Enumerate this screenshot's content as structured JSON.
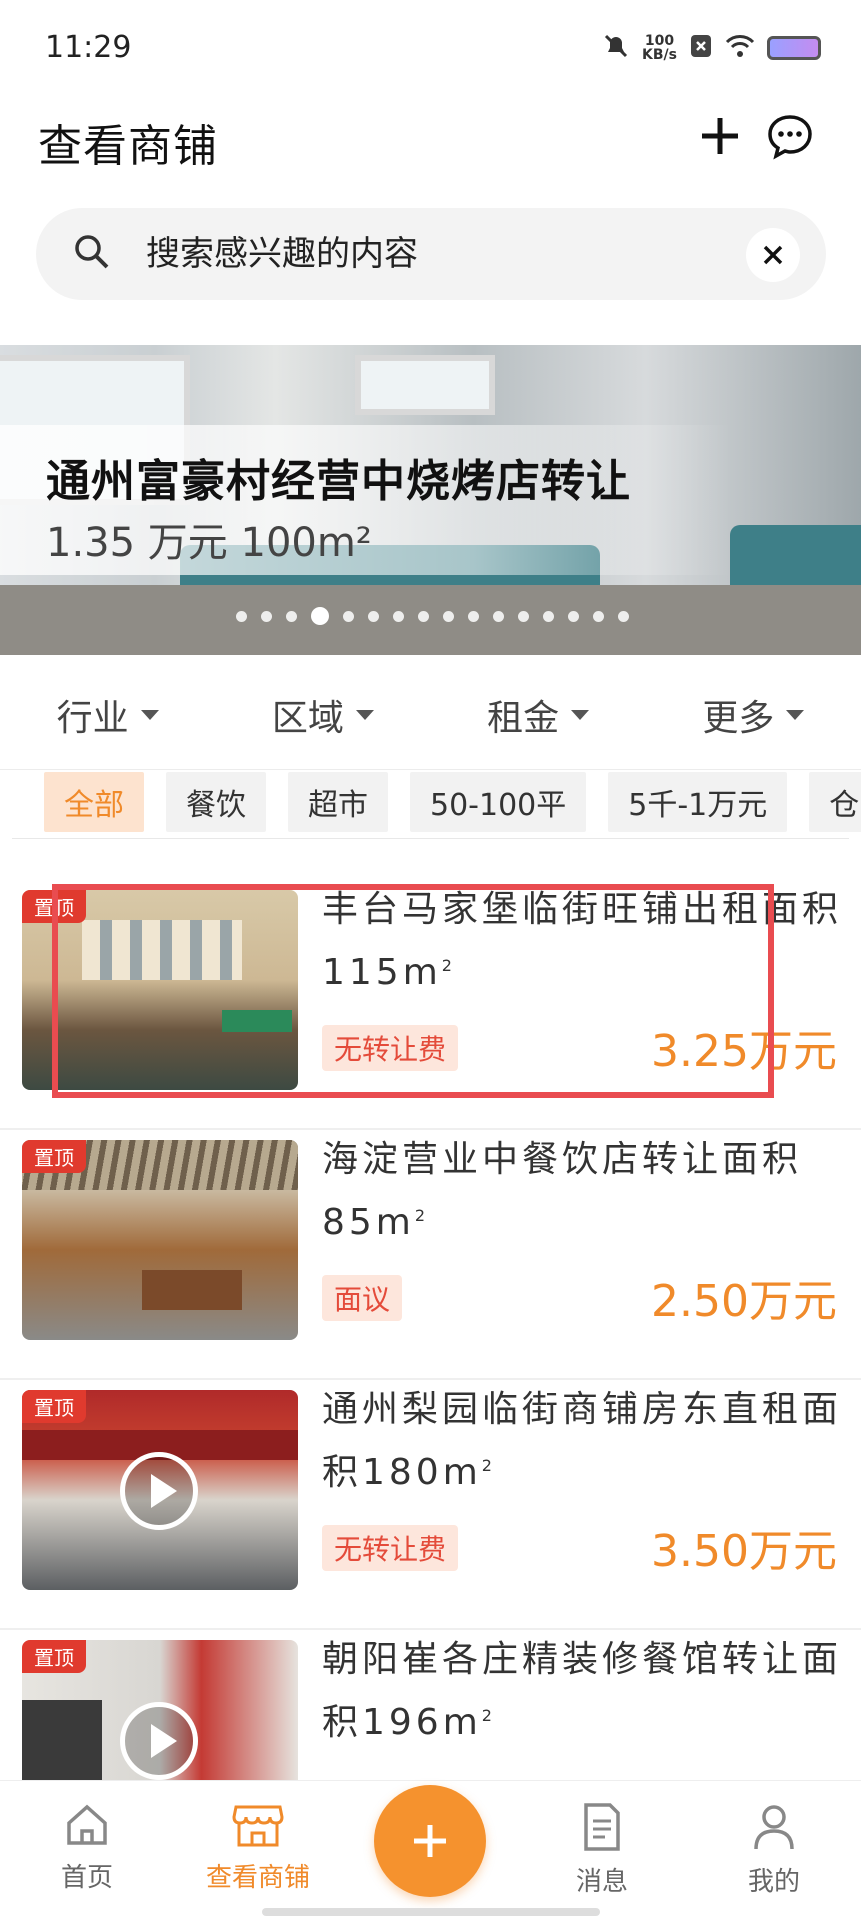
{
  "status_bar": {
    "time": "11:29",
    "net_speed_value": "100",
    "net_speed_unit": "KB/s"
  },
  "header": {
    "title": "查看商铺"
  },
  "search": {
    "placeholder": "搜索感兴趣的内容"
  },
  "banner": {
    "title": "通州富豪村经营中烧烤店转让",
    "subtitle": "1.35 万元 100m²",
    "dot_count": 16,
    "active_dot": 3
  },
  "filters": [
    {
      "label": "行业"
    },
    {
      "label": "区域"
    },
    {
      "label": "租金"
    },
    {
      "label": "更多"
    }
  ],
  "tags": [
    {
      "label": "全部",
      "active": true
    },
    {
      "label": "餐饮"
    },
    {
      "label": "超市"
    },
    {
      "label": "50-100平"
    },
    {
      "label": "5千-1万元"
    },
    {
      "label": "仓"
    }
  ],
  "listings": [
    {
      "badge": "置顶",
      "title": "丰台马家堡临街旺铺出租面积115m",
      "area_sup": "2",
      "fee": "无转让费",
      "price": "3.25万元",
      "video": false
    },
    {
      "badge": "置顶",
      "title": "海淀营业中餐饮店转让面积85m",
      "area_sup": "2",
      "fee": "面议",
      "price": "2.50万元",
      "video": false
    },
    {
      "badge": "置顶",
      "title": "通州梨园临街商铺房东直租面积180m",
      "area_sup": "2",
      "fee": "无转让费",
      "price": "3.50万元",
      "video": true
    },
    {
      "badge": "置顶",
      "title": "朝阳崔各庄精装修餐馆转让面积196m",
      "area_sup": "2",
      "fee": "",
      "price": "",
      "video": true
    }
  ],
  "bottom_nav": {
    "items": [
      {
        "label": "首页"
      },
      {
        "label": "查看商铺",
        "active": true
      },
      {
        "label": "消息"
      },
      {
        "label": "我的"
      }
    ]
  },
  "colors": {
    "accent": "#f08a2a",
    "badge_red": "#e03a2e",
    "highlight": "#e94c50",
    "fee_bg": "#fde6dc"
  }
}
